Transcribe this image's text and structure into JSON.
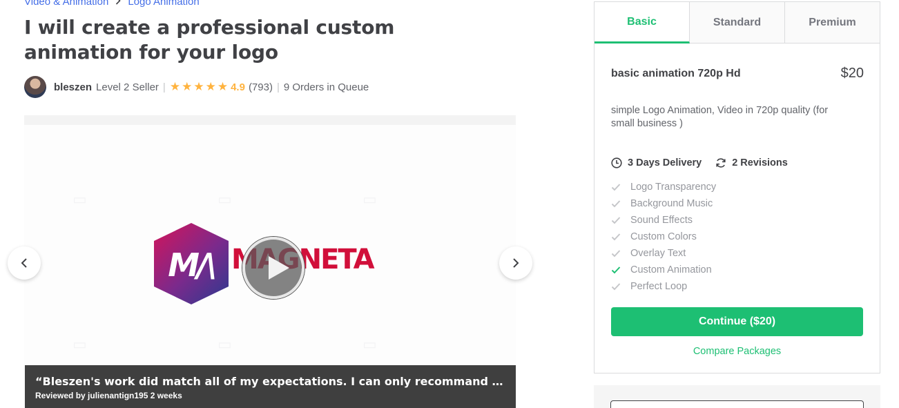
{
  "breadcrumb": {
    "items": [
      "Video & Animation",
      "Logo Animation"
    ]
  },
  "gig": {
    "title": "I will create a professional custom animation for your logo"
  },
  "seller": {
    "name": "bleszen",
    "level": "Level 2 Seller",
    "rating": "4.9",
    "reviews_count": "(793)",
    "queue": "9 Orders in Queue",
    "stars": 5
  },
  "gallery": {
    "logo_mark": "M/\\",
    "logo_word": "MAGNETA",
    "review_quote": "“Bleszen's work did match all of my expectations. I can only recommand his services....",
    "review_meta": "Reviewed by julienantign195 2 weeks"
  },
  "packages": {
    "tabs": [
      "Basic",
      "Standard",
      "Premium"
    ],
    "active_tab": "Basic",
    "name": "basic animation 720p Hd",
    "price": "$20",
    "description": "simple Logo Animation, Video in 720p quality (for small business )",
    "delivery": "3 Days Delivery",
    "revisions": "2 Revisions",
    "features": [
      {
        "label": "Logo Transparency",
        "included": false
      },
      {
        "label": "Background Music",
        "included": false
      },
      {
        "label": "Sound Effects",
        "included": false
      },
      {
        "label": "Custom Colors",
        "included": false
      },
      {
        "label": "Overlay Text",
        "included": false
      },
      {
        "label": "Custom Animation",
        "included": true
      },
      {
        "label": "Perfect Loop",
        "included": false
      }
    ],
    "continue_label": "Continue ($20)",
    "compare_label": "Compare Packages"
  },
  "colors": {
    "accent": "#1dbf73",
    "star": "#ffb33e",
    "link": "#446ee7"
  },
  "icons": {
    "nav_prev": "chevron-left-icon",
    "nav_next": "chevron-right-icon",
    "play": "play-icon",
    "clock": "clock-icon",
    "refresh": "refresh-icon",
    "check": "check-icon"
  }
}
